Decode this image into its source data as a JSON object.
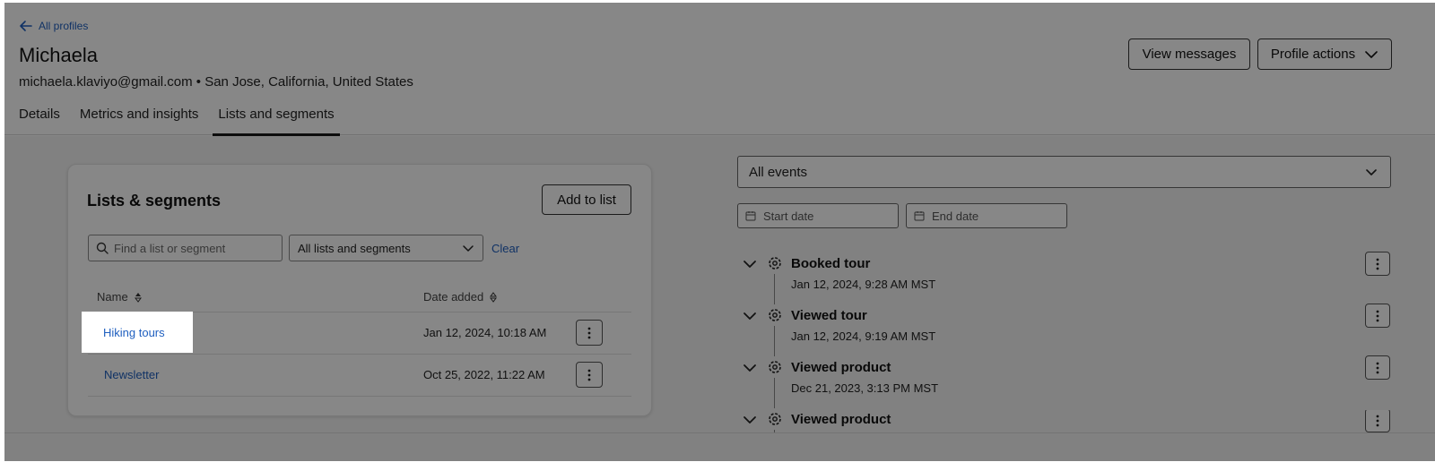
{
  "header": {
    "back_label": "All profiles",
    "name": "Michaela",
    "meta": "michaela.klaviyo@gmail.com • San Jose, California, United States",
    "view_messages_label": "View messages",
    "profile_actions_label": "Profile actions"
  },
  "tabs": [
    {
      "label": "Details"
    },
    {
      "label": "Metrics and insights"
    },
    {
      "label": "Lists and segments",
      "active": true
    }
  ],
  "lists_card": {
    "title": "Lists & segments",
    "add_button_label": "Add to list",
    "search_placeholder": "Find a list or segment",
    "filter_value": "All lists and segments",
    "clear_label": "Clear",
    "columns": {
      "name": "Name",
      "date_added": "Date added"
    },
    "rows": [
      {
        "name": "Hiking tours",
        "date": "Jan 12, 2024, 10:18 AM"
      },
      {
        "name": "Newsletter",
        "date": "Oct 25, 2022, 11:22 AM"
      }
    ]
  },
  "activity": {
    "events_filter": "All events",
    "start_date_placeholder": "Start date",
    "end_date_placeholder": "End date",
    "events": [
      {
        "title": "Booked tour",
        "time": "Jan 12, 2024, 9:28 AM MST"
      },
      {
        "title": "Viewed tour",
        "time": "Jan 12, 2024, 9:19 AM MST"
      },
      {
        "title": "Viewed product",
        "time": "Dec 21, 2023, 3:13 PM MST"
      },
      {
        "title": "Viewed product",
        "time": ""
      }
    ]
  },
  "colors": {
    "link": "#1f5fbf",
    "overlay": "rgba(0,0,0,0.47)"
  }
}
